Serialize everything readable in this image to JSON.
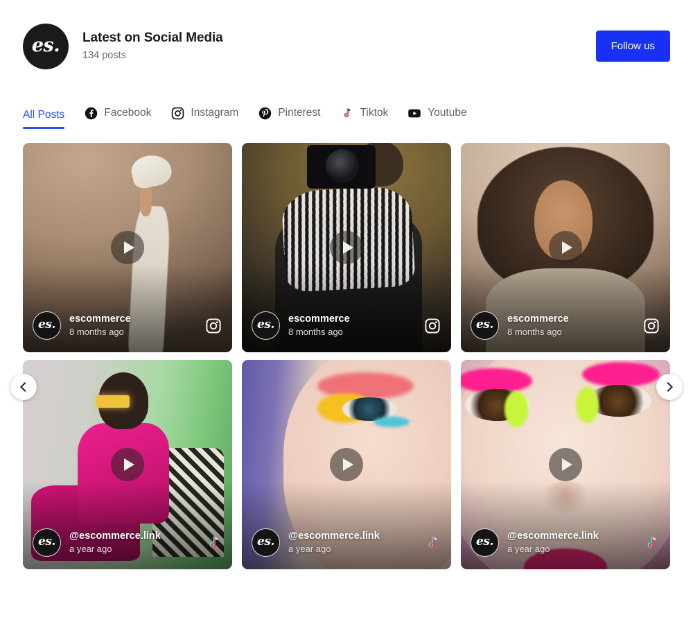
{
  "header": {
    "logo_glyph": "es.",
    "logo_icon": "es-brand-logo",
    "title": "Latest on Social Media",
    "post_count": "134 posts",
    "follow_label": "Follow us",
    "accent_color": "#1831f5"
  },
  "tabs": [
    {
      "label": "All Posts",
      "icon": "",
      "active": true
    },
    {
      "label": "Facebook",
      "icon": "facebook-icon",
      "active": false
    },
    {
      "label": "Instagram",
      "icon": "instagram-icon",
      "active": false
    },
    {
      "label": "Pinterest",
      "icon": "pinterest-icon",
      "active": false
    },
    {
      "label": "Tiktok",
      "icon": "tiktok-icon",
      "active": false
    },
    {
      "label": "Youtube",
      "icon": "youtube-icon",
      "active": false
    }
  ],
  "tab_active_color": "#2b4bf2",
  "tab_inactive_color": "#5f6368",
  "carousel": {
    "prev_label": "Previous",
    "next_label": "Next",
    "prev_icon": "chevron-left-icon",
    "next_icon": "chevron-right-icon"
  },
  "posts": [
    {
      "username": "escommerce",
      "time": "8 months ago",
      "network": "instagram",
      "network_icon": "instagram-icon",
      "avatar_glyph": "es.",
      "has_video": true,
      "media_alt": "Person's leg raised wearing cream trousers and a white sneaker on a beige backdrop"
    },
    {
      "username": "escommerce",
      "time": "8 months ago",
      "network": "instagram",
      "network_icon": "instagram-icon",
      "avatar_glyph": "es.",
      "has_video": true,
      "media_alt": "Photographer in a black and white striped shirt holding a camera"
    },
    {
      "username": "escommerce",
      "time": "8 months ago",
      "network": "instagram",
      "network_icon": "instagram-icon",
      "avatar_glyph": "es.",
      "has_video": true,
      "media_alt": "Woman with voluminous curly hair wearing a beige coat"
    },
    {
      "username": "@escommerce.link",
      "time": "a year ago",
      "network": "tiktok",
      "network_icon": "tiktok-icon",
      "avatar_glyph": "es.",
      "has_video": true,
      "media_alt": "Woman in a pink suit and gold sunglasses writing while seated in a patterned chair"
    },
    {
      "username": "@escommerce.link",
      "time": "a year ago",
      "network": "tiktok",
      "network_icon": "tiktok-icon",
      "avatar_glyph": "es.",
      "has_video": true,
      "media_alt": "Close-up of a face with pink, yellow and blue eye makeup"
    },
    {
      "username": "@escommerce.link",
      "time": "a year ago",
      "network": "tiktok",
      "network_icon": "tiktok-icon",
      "avatar_glyph": "es.",
      "has_video": true,
      "media_alt": "Close-up of a face with neon pink and green eye makeup"
    }
  ]
}
